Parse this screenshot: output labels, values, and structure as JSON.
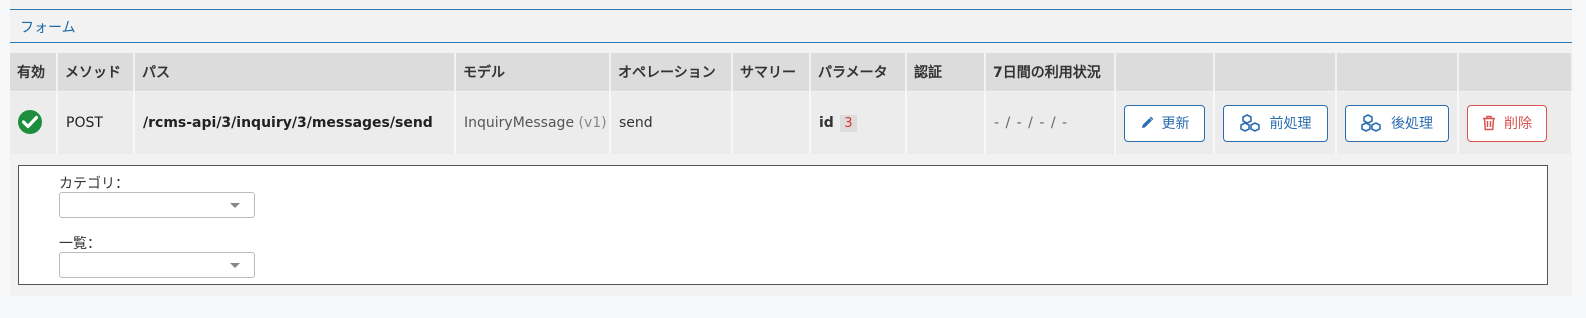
{
  "section": {
    "title": "フォーム"
  },
  "table": {
    "headers": [
      "有効",
      "メソッド",
      "パス",
      "モデル",
      "オペレーション",
      "サマリー",
      "パラメータ",
      "認証",
      "7日間の利用状況",
      "",
      "",
      "",
      ""
    ],
    "row": {
      "enabled": true,
      "method": "POST",
      "path": "/rcms-api/3/inquiry/3/messages/send",
      "model_name": "InquiryMessage",
      "model_version": "(v1)",
      "operation": "send",
      "summary": "",
      "param_name": "id",
      "param_value": "3",
      "auth": "",
      "usage": "- / - / - / -"
    }
  },
  "buttons": {
    "update": "更新",
    "preprocess": "前処理",
    "postprocess": "後処理",
    "delete": "削除"
  },
  "detail": {
    "category_label": "カテゴリ：",
    "category_value": "",
    "list_label": "一覧：",
    "list_value": ""
  },
  "colors": {
    "accent": "#2a6db0",
    "danger": "#d9534f",
    "success": "#1e8e3e",
    "param_badge_text": "#e03131"
  }
}
